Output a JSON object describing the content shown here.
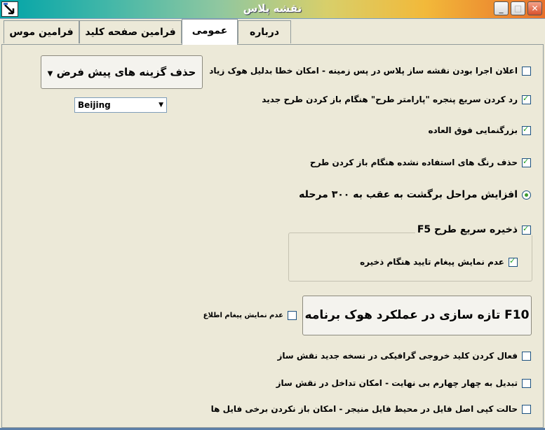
{
  "window": {
    "title": "نقشه پلاس"
  },
  "tabs": [
    {
      "label": "درباره",
      "active": false
    },
    {
      "label": "عمومی",
      "active": true
    },
    {
      "label": "فرامین صفحه کلید",
      "active": false
    },
    {
      "label": "فرامین موس",
      "active": false
    }
  ],
  "options": {
    "bg_run_notice": {
      "label": "اعلان اجرا بودن نقشه ساز پلاس در پس زمینه - امکان خطا بدلیل هوک زیاد",
      "checked": false
    },
    "fast_reject": {
      "label": "رد کردن سریع پنجره \"پارامتر طرح\" هنگام باز کردن طرح جدید",
      "checked": true
    },
    "super_zoom": {
      "label": "بزرگنمایی فوق العاده",
      "checked": true
    },
    "remove_unused_colors": {
      "label": "حذف رنگ های استفاده نشده هنگام باز کردن طرح",
      "checked": true
    },
    "undo_steps": {
      "label": "افزایش مراحل برگشت به عقب به ۳۰۰ مرحله",
      "selected": true
    },
    "quick_save": {
      "label": "ذخیره سریع طرح F5",
      "checked": true
    },
    "no_save_confirm": {
      "label": "عدم نمایش پیغام تایید هنگام ذخیره",
      "checked": true
    },
    "no_notice": {
      "label": "عدم نمایش پیغام اطلاع",
      "checked": false
    },
    "graphic_output_key": {
      "label": "فعال کردن کلید خروجی گرافیکی در نسخه جدید نقش ساز",
      "checked": false
    },
    "quad_infinite": {
      "label": "تبدیل به چهار چهارم بی نهایت - امکان تداخل در نقش ساز",
      "checked": false
    },
    "copy_original": {
      "label": "حالت کپی اصل فایل در محیط فایل منیجر - امکان باز نکردن برخی فایل ها",
      "checked": false
    }
  },
  "buttons": {
    "delete_defaults": "حذف گزینه های پیش فرض",
    "refresh_hook": "تازه سازی در عملکرد هوک برنامه F10"
  },
  "timezone_select": {
    "value": "Beijing"
  },
  "icons": {
    "minimize": "minimize-icon",
    "maximize": "maximize-icon",
    "close": "close-icon"
  }
}
